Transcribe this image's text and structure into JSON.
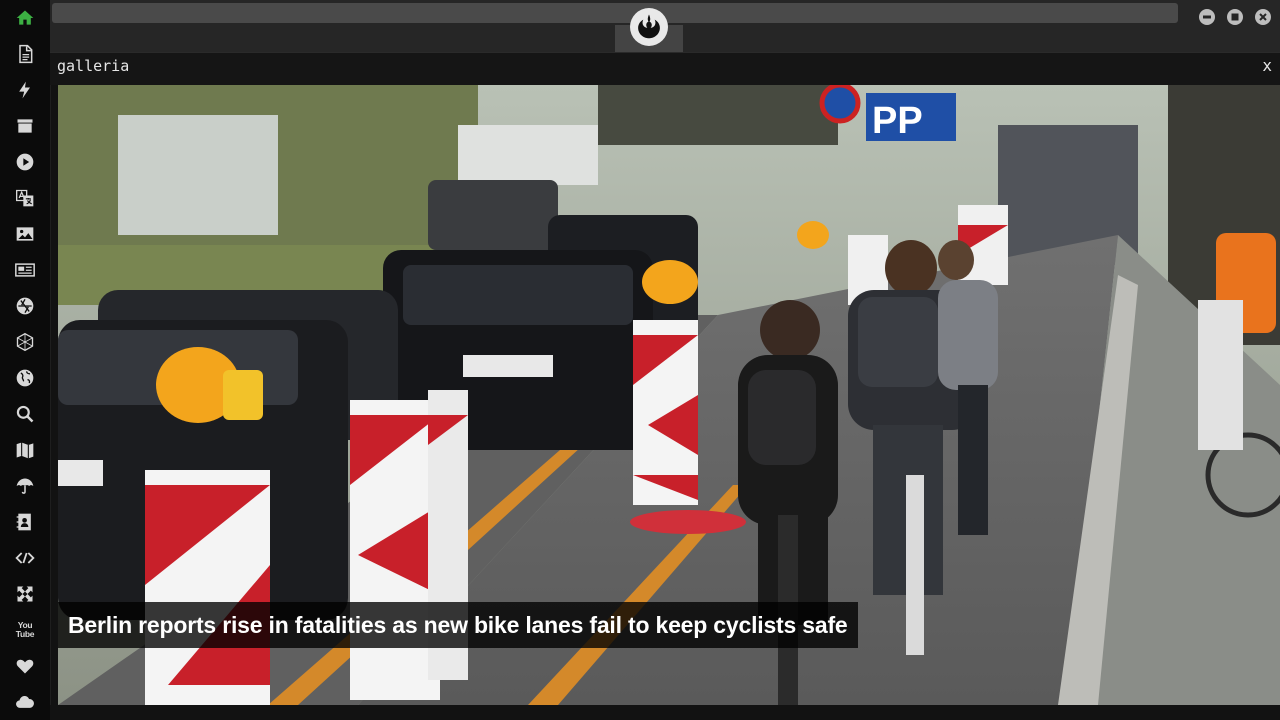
{
  "sidebar": {
    "items": [
      {
        "name": "home-icon",
        "active": true
      },
      {
        "name": "document-icon"
      },
      {
        "name": "lightning-icon"
      },
      {
        "name": "archive-icon"
      },
      {
        "name": "play-icon"
      },
      {
        "name": "translate-icon"
      },
      {
        "name": "image-icon"
      },
      {
        "name": "newspaper-icon"
      },
      {
        "name": "aperture-icon"
      },
      {
        "name": "hexagon-icon"
      },
      {
        "name": "globe-icon"
      },
      {
        "name": "search-icon"
      },
      {
        "name": "map-icon"
      },
      {
        "name": "umbrella-icon"
      },
      {
        "name": "contact-card-icon"
      },
      {
        "name": "code-icon"
      },
      {
        "name": "expand-icon"
      },
      {
        "name": "youtube-icon",
        "label": "You Tube"
      },
      {
        "name": "heart-icon"
      },
      {
        "name": "cloud-icon"
      }
    ],
    "accent_color": "#3cb043"
  },
  "panel": {
    "title": "galleria",
    "close_label": "x"
  },
  "gallery": {
    "caption": "Berlin reports rise in fatalities as new bike lanes fail to keep cyclists safe",
    "sign_text": "PP"
  }
}
